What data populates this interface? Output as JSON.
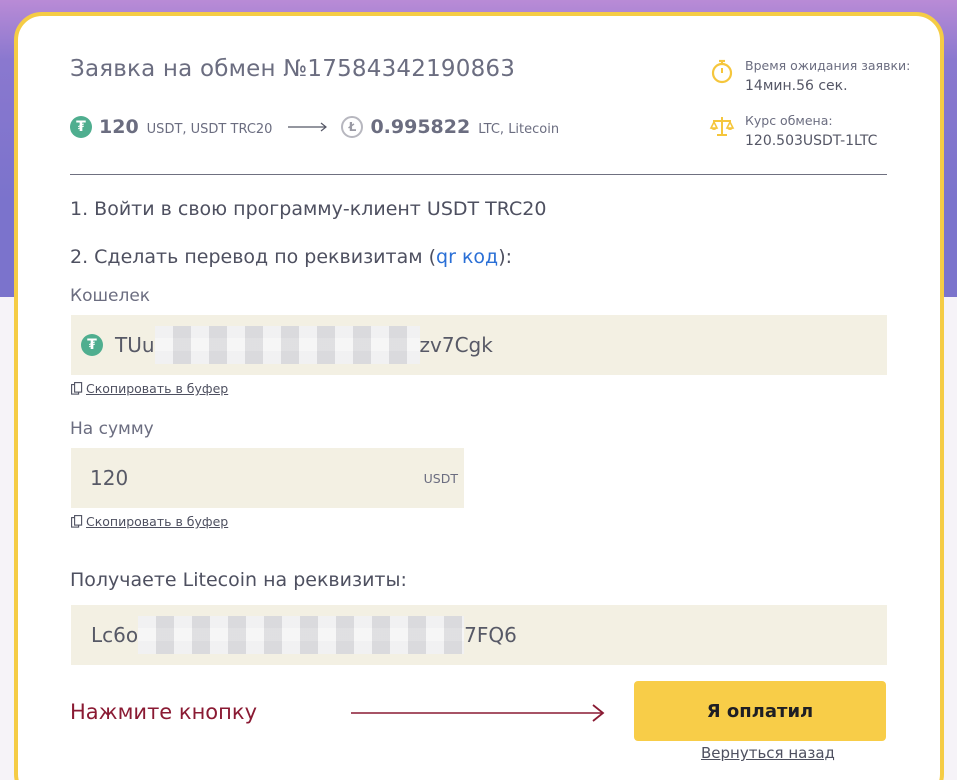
{
  "order": {
    "title": "Заявка на обмен №17584342190863",
    "from": {
      "amount": "120",
      "currency": "USDT, USDT TRC20",
      "icon": "tether-icon"
    },
    "to": {
      "amount": "0.995822",
      "currency": "LTC, Litecoin",
      "icon": "litecoin-icon"
    }
  },
  "info": {
    "wait_label": "Время ожидания заявки:",
    "wait_value": "14мин.56 сек.",
    "rate_label": "Курс обмена:",
    "rate_value": "120.503USDT-1LTC"
  },
  "steps": {
    "step1": "1. Войти в свою программу-клиент USDT TRC20",
    "step2_prefix": "2. Сделать перевод по реквизитам (",
    "step2_link": "qr код",
    "step2_suffix": "):"
  },
  "wallet": {
    "label": "Кошелек",
    "prefix": "TUu",
    "suffix": "zv7Cgk",
    "copy_label": "Скопировать в буфер"
  },
  "sum": {
    "label": "На сумму",
    "value": "120",
    "currency": "USDT",
    "copy_label": "Скопировать в буфер"
  },
  "receive": {
    "label": "Получаете Litecoin на реквизиты:",
    "prefix": "Lc6o",
    "suffix": "7FQ6"
  },
  "actions": {
    "hint": "Нажмите кнопку",
    "paid_button": "Я оплатил",
    "back_link": "Вернуться назад"
  },
  "colors": {
    "accent_yellow": "#f8cd48",
    "hint_red": "#8a1a33",
    "link_blue": "#2a6fd6",
    "field_bg": "#f3f0e3"
  }
}
